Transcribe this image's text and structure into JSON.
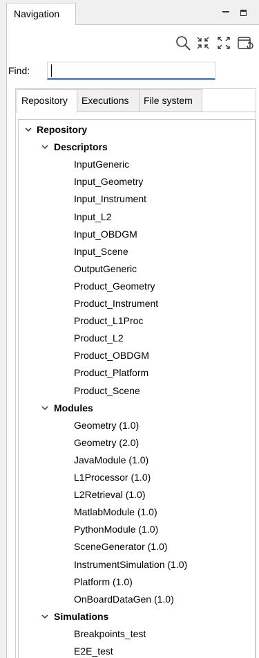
{
  "view": {
    "title": "Navigation"
  },
  "find": {
    "label": "Find:",
    "value": ""
  },
  "tabs": [
    {
      "label": "Repository"
    },
    {
      "label": "Executions"
    },
    {
      "label": "File system"
    }
  ],
  "tree": {
    "root": "Repository",
    "groups": [
      {
        "label": "Descriptors",
        "items": [
          "InputGeneric",
          "Input_Geometry",
          "Input_Instrument",
          "Input_L2",
          "Input_OBDGM",
          "Input_Scene",
          "OutputGeneric",
          "Product_Geometry",
          "Product_Instrument",
          "Product_L1Proc",
          "Product_L2",
          "Product_OBDGM",
          "Product_Platform",
          "Product_Scene"
        ]
      },
      {
        "label": "Modules",
        "items": [
          "Geometry (1.0)",
          "Geometry (2.0)",
          "JavaModule (1.0)",
          "L1Processor (1.0)",
          "L2Retrieval (1.0)",
          "MatlabModule (1.0)",
          "PythonModule (1.0)",
          "SceneGenerator (1.0)",
          "InstrumentSimulation (1.0)",
          "Platform (1.0)",
          "OnBoardDataGen (1.0)"
        ]
      },
      {
        "label": "Simulations",
        "items": [
          "Breakpoints_test",
          "E2E_test"
        ]
      }
    ]
  },
  "icons": {
    "search": "search-icon",
    "collapse": "collapse-all-icon",
    "expand": "expand-all-icon",
    "refresh": "refresh-icon"
  }
}
